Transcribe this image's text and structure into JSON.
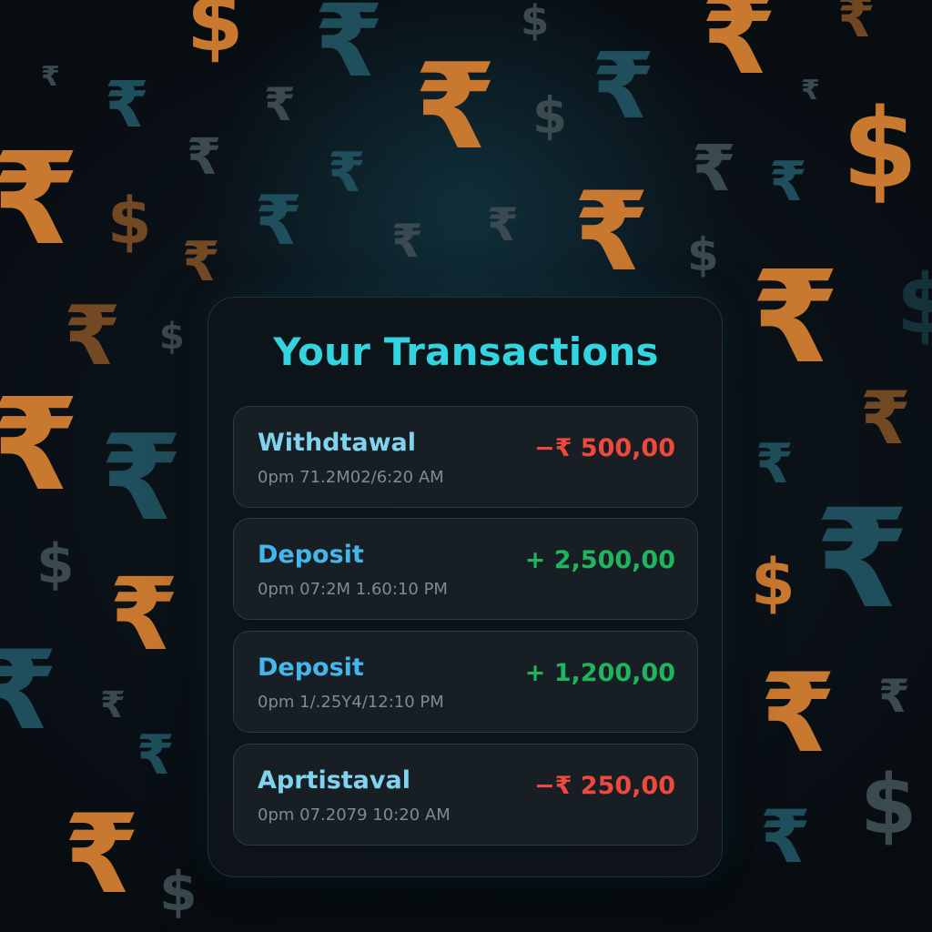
{
  "screen": {
    "title": "Your Transactions"
  },
  "transactions": [
    {
      "type": "Withdtawal",
      "timestamp": "0pm 71.2M02/6:20 AM",
      "amount": "−₹ 500,00",
      "direction": "debit"
    },
    {
      "type": "Deposit",
      "timestamp": "0pm 07:2M 1.60:10 PM",
      "amount": "+ 2,500,00",
      "direction": "credit"
    },
    {
      "type": "Deposit",
      "timestamp": "0pm 1/.25Y4/12:10 PM",
      "amount": "+ 1,200,00",
      "direction": "credit"
    },
    {
      "type": "Aprtistaval",
      "timestamp": "0pm 07.2079 10:20 AM",
      "amount": "−₹ 250,00",
      "direction": "debit"
    }
  ],
  "background": {
    "symbol_rupee": "₹",
    "symbol_dollar": "$"
  },
  "colors": {
    "title": "#33d3e0",
    "debit": "#f0483c",
    "credit": "#22b35e",
    "accent_orange": "#c9782f",
    "accent_teal": "#1f4f5c"
  }
}
